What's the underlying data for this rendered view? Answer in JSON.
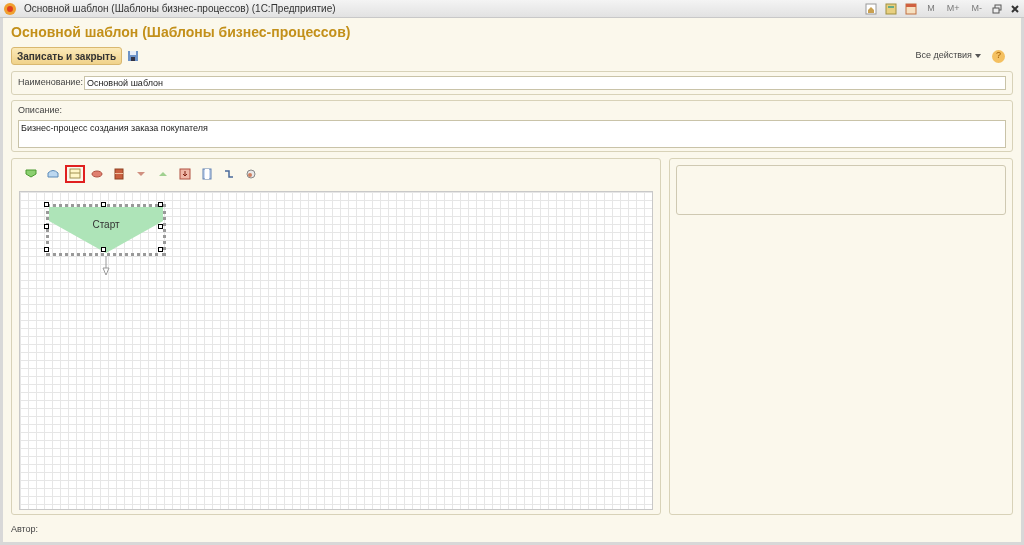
{
  "window": {
    "title": "Основной шаблон (Шаблоны бизнес-процессов) (1С:Предприятие)",
    "tools": [
      {
        "kind": "home"
      },
      {
        "kind": "calculator"
      },
      {
        "kind": "calendar"
      }
    ],
    "memory_buttons": [
      "M",
      "M+",
      "M-"
    ]
  },
  "form": {
    "title": "Основной шаблон (Шаблоны бизнес-процессов)",
    "save_close_button": "Записать и закрыть",
    "all_actions": "Все действия",
    "help": "?"
  },
  "name_field": {
    "label": "Наименование:",
    "value": "Основной шаблон"
  },
  "description": {
    "label": "Описание:",
    "value": "Бизнес-процесс создания заказа покупателя"
  },
  "map_tools": [
    {
      "kind": "start",
      "selected": false
    },
    {
      "kind": "point",
      "selected": false
    },
    {
      "kind": "activity",
      "selected": true
    },
    {
      "kind": "condition",
      "selected": false
    },
    {
      "kind": "stop",
      "selected": false
    },
    {
      "kind": "split",
      "selected": false
    },
    {
      "kind": "merge",
      "selected": false
    },
    {
      "kind": "nested",
      "selected": false
    },
    {
      "kind": "handler",
      "selected": false
    },
    {
      "kind": "connector",
      "selected": false
    },
    {
      "kind": "decoration",
      "selected": false
    }
  ],
  "map": {
    "nodes": [
      {
        "kind": "start",
        "label": "Старт",
        "selected": true
      }
    ]
  },
  "author": {
    "label": "Автор:"
  }
}
